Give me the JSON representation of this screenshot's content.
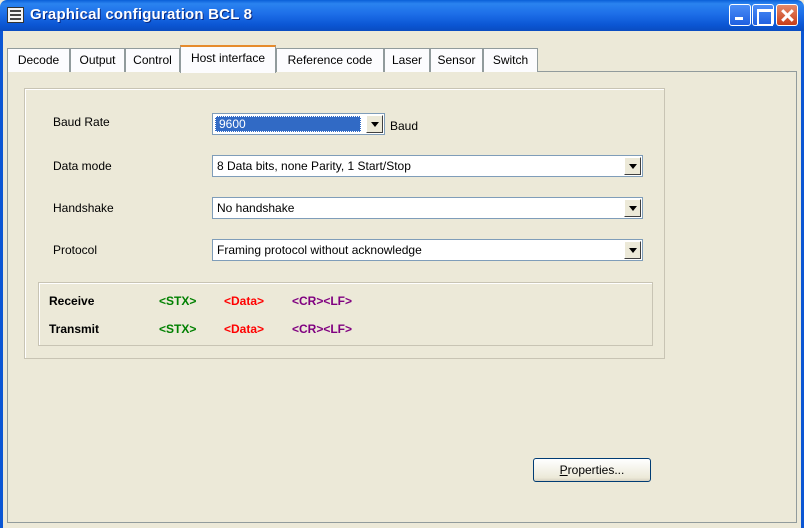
{
  "window": {
    "title": "Graphical configuration BCL 8"
  },
  "tabs": [
    {
      "label": "Decode"
    },
    {
      "label": "Output"
    },
    {
      "label": "Control"
    },
    {
      "label": "Host interface",
      "active": true
    },
    {
      "label": "Reference code"
    },
    {
      "label": "Laser"
    },
    {
      "label": "Sensor"
    },
    {
      "label": "Switch"
    }
  ],
  "form": {
    "baud_rate": {
      "label": "Baud Rate",
      "value": "9600",
      "unit": "Baud"
    },
    "data_mode": {
      "label": "Data mode",
      "value": "8 Data bits, none Parity, 1 Start/Stop"
    },
    "handshake": {
      "label": "Handshake",
      "value": "No handshake"
    },
    "protocol": {
      "label": "Protocol",
      "value": "Framing protocol without acknowledge"
    }
  },
  "frame_preview": {
    "receive": {
      "label": "Receive",
      "stx": "<STX>",
      "data": "<Data>",
      "crlf": "<CR><LF>"
    },
    "transmit": {
      "label": "Transmit",
      "stx": "<STX>",
      "data": "<Data>",
      "crlf": "<CR><LF>"
    }
  },
  "buttons": {
    "properties_mnemonic": "P",
    "properties_rest": "roperties..."
  },
  "colors": {
    "title_bar": "#0b56d4",
    "active_tab_accent": "#e68b2c",
    "selection": "#316ac5",
    "stx": "#008000",
    "data": "#ff0000",
    "crlf": "#800080"
  }
}
